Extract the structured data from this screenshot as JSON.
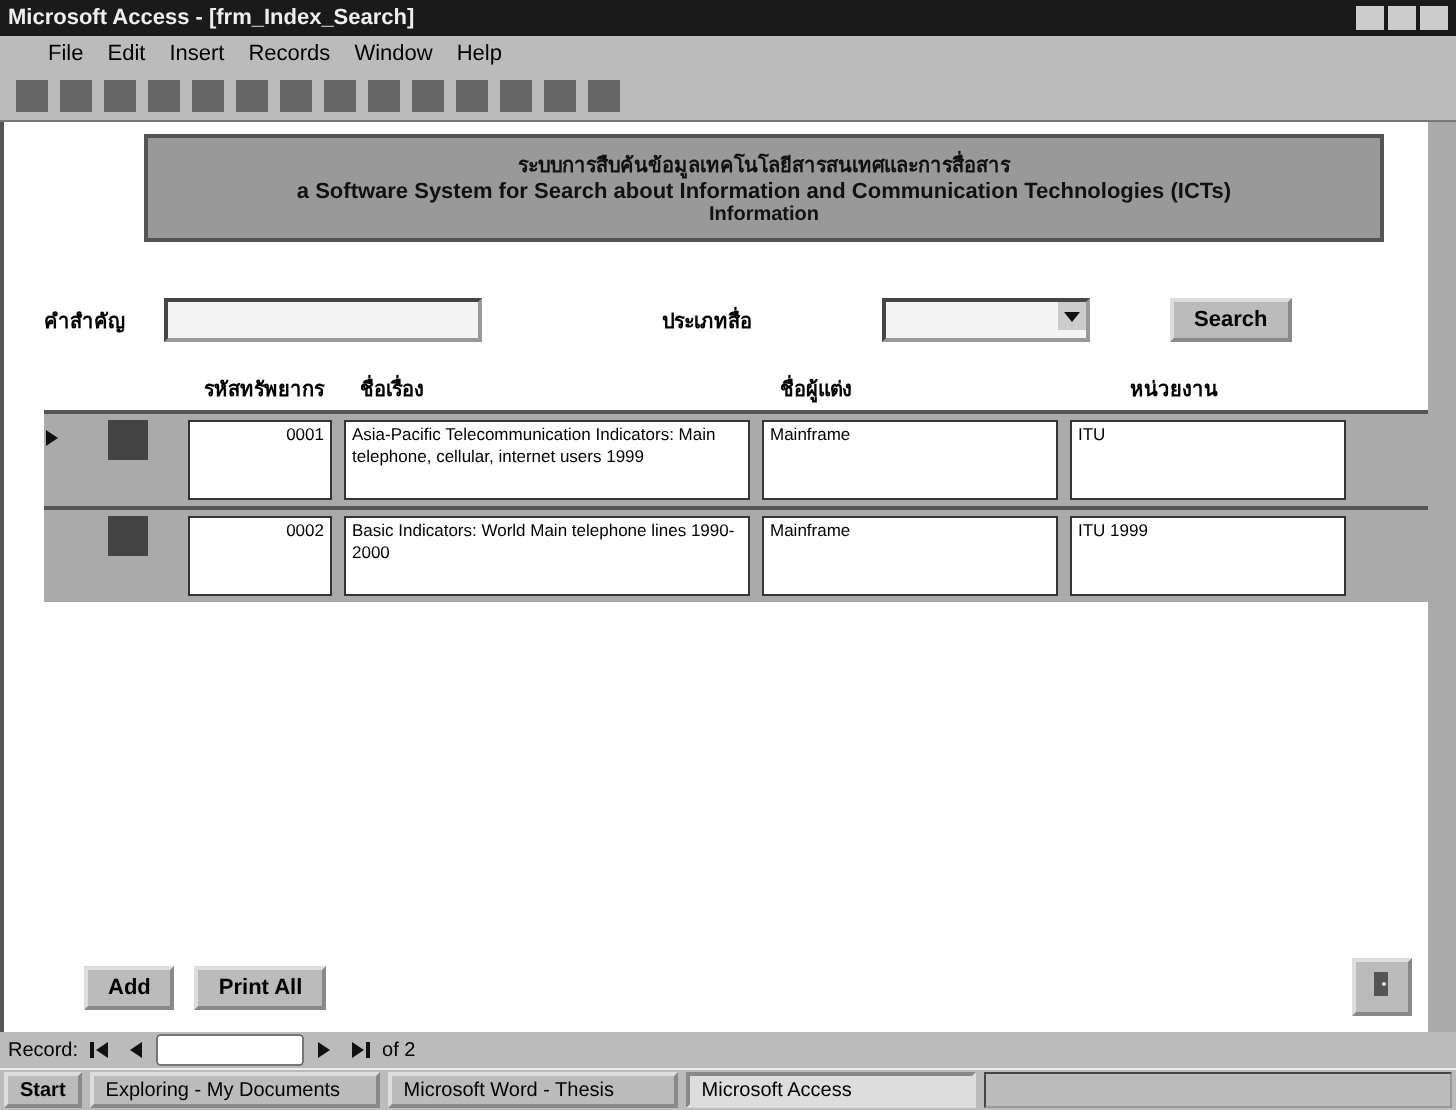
{
  "window": {
    "title": "Microsoft Access - [frm_Index_Search]"
  },
  "menu": [
    "File",
    "Edit",
    "Insert",
    "Records",
    "Window",
    "Help"
  ],
  "header": {
    "line_1": "ระบบการสืบค้นข้อมูลเทคโนโลยีสารสนเทศและการสื่อสาร",
    "line_2": "a Software System for Search about Information and Communication Technologies (ICTs)",
    "line_3": "Information"
  },
  "search": {
    "keyword_label": "คำสำคัญ",
    "type_label": "ประเภทสื่อ",
    "button": "Search"
  },
  "columns": [
    "รหัสทรัพยากร",
    "ชื่อเรื่อง",
    "ชื่อผู้แต่ง",
    "หน่วยงาน"
  ],
  "rows": [
    {
      "current": true,
      "id": "0001",
      "title": "Asia-Pacific Telecommunication Indicators: Main telephone, cellular, internet users 1999",
      "author": "Mainframe",
      "agency": "ITU"
    },
    {
      "current": false,
      "id": "0002",
      "title": "Basic Indicators: World Main telephone lines 1990-2000",
      "author": "Mainframe",
      "agency": "ITU 1999"
    }
  ],
  "buttons": [
    "Add",
    "Print All"
  ],
  "record_nav": {
    "label": "Record:",
    "of": "of 2"
  },
  "taskbar": {
    "start": "Start",
    "tasks": [
      {
        "label": "Exploring - My Documents",
        "selected": false
      },
      {
        "label": "Microsoft Word - Thesis",
        "selected": false
      },
      {
        "label": "Microsoft Access",
        "selected": true
      }
    ]
  }
}
